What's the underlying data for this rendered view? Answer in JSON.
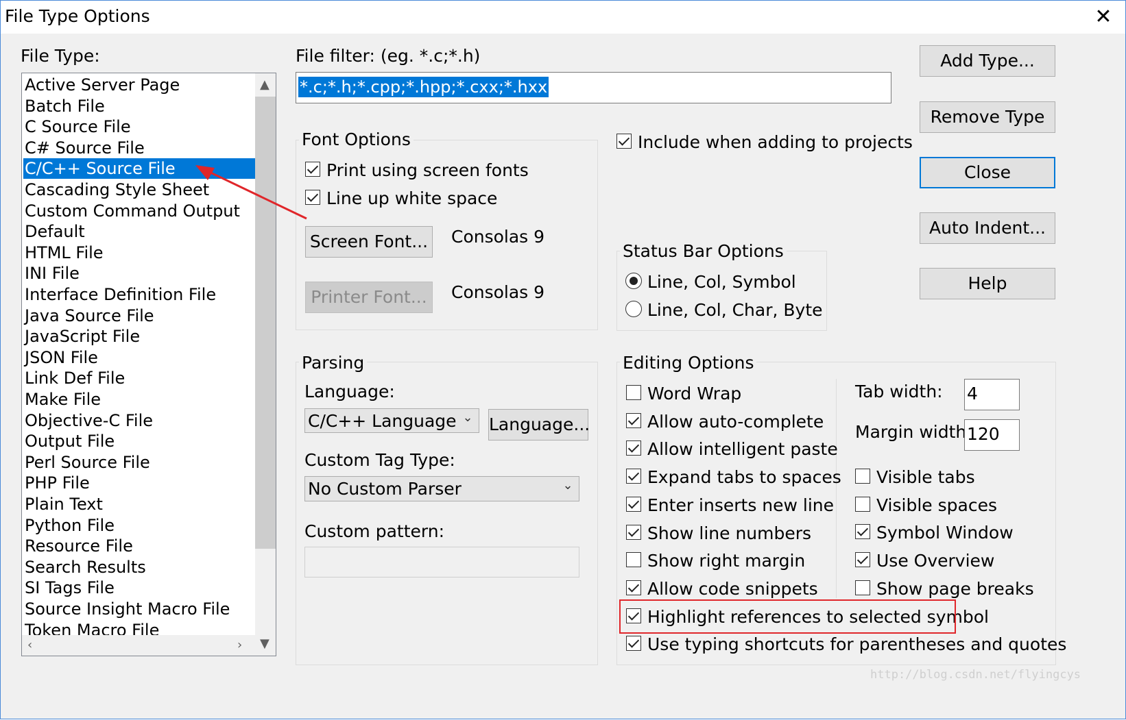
{
  "window": {
    "title": "File Type Options",
    "close_glyph": "✕"
  },
  "file_type": {
    "label": "File Type:",
    "items": [
      "Active Server Page",
      "Batch File",
      "C Source File",
      "C# Source File",
      "C/C++ Source File",
      "Cascading Style Sheet",
      "Custom Command Output",
      "Default",
      "HTML File",
      "INI File",
      "Interface Definition File",
      "Java Source File",
      "JavaScript File",
      "JSON File",
      "Link Def File",
      "Make File",
      "Objective-C File",
      "Output File",
      "Perl Source File",
      "PHP File",
      "Plain Text",
      "Python File",
      "Resource File",
      "Search Results",
      "SI Tags File",
      "Source Insight Macro File",
      "Token Macro File"
    ],
    "selected": "C/C++ Source File"
  },
  "file_filter": {
    "label": "File filter: (eg. *.c;*.h)",
    "value": "*.c;*.h;*.cpp;*.hpp;*.cxx;*.hxx"
  },
  "include_in_projects": {
    "label": "Include when adding to projects",
    "checked": true
  },
  "font_options": {
    "title": "Font Options",
    "print_screen_fonts": {
      "label": "Print using screen fonts",
      "checked": true
    },
    "line_up_whitespace": {
      "label": "Line up white space",
      "checked": true
    },
    "screen_font_button": "Screen Font...",
    "screen_font_value": "Consolas 9",
    "printer_font_button": "Printer Font...",
    "printer_font_value": "Consolas 9"
  },
  "status_bar": {
    "title": "Status Bar Options",
    "options": [
      "Line, Col, Symbol",
      "Line, Col, Char, Byte"
    ],
    "selected": "Line, Col, Symbol"
  },
  "parsing": {
    "title": "Parsing",
    "language_label": "Language:",
    "language_value": "C/C++ Language",
    "language_button": "Language...",
    "custom_tag_label": "Custom Tag Type:",
    "custom_tag_value": "No Custom Parser",
    "custom_pattern_label": "Custom pattern:",
    "custom_pattern_value": ""
  },
  "editing": {
    "title": "Editing Options",
    "left_options": [
      {
        "label": "Word Wrap",
        "checked": false
      },
      {
        "label": "Allow auto-complete",
        "checked": true
      },
      {
        "label": "Allow intelligent paste",
        "checked": true
      },
      {
        "label": "Expand tabs to spaces",
        "checked": true
      },
      {
        "label": "Enter inserts new line",
        "checked": true
      },
      {
        "label": "Show line numbers",
        "checked": true
      },
      {
        "label": "Show right margin",
        "checked": false
      },
      {
        "label": "Allow code snippets",
        "checked": true
      },
      {
        "label": "Highlight references to selected symbol",
        "checked": true
      },
      {
        "label": "Use typing shortcuts for parentheses and quotes",
        "checked": true
      }
    ],
    "tab_width_label": "Tab width:",
    "tab_width_value": "4",
    "margin_width_label": "Margin width:",
    "margin_width_value": "120",
    "right_options": [
      {
        "label": "Visible tabs",
        "checked": false
      },
      {
        "label": "Visible spaces",
        "checked": false
      },
      {
        "label": "Symbol Window",
        "checked": true
      },
      {
        "label": "Use Overview",
        "checked": true
      },
      {
        "label": "Show page breaks",
        "checked": false
      }
    ]
  },
  "side_buttons": {
    "add_type": "Add Type...",
    "remove_type": "Remove Type",
    "close": "Close",
    "auto_indent": "Auto Indent...",
    "help": "Help"
  },
  "annotation": {
    "color": "#e0262a"
  },
  "watermark": "http://blog.csdn.net/flyingcys",
  "colors": {
    "selection": "#0078d7",
    "annotation": "#e0262a",
    "dialog_bg": "#f0f0f0"
  }
}
